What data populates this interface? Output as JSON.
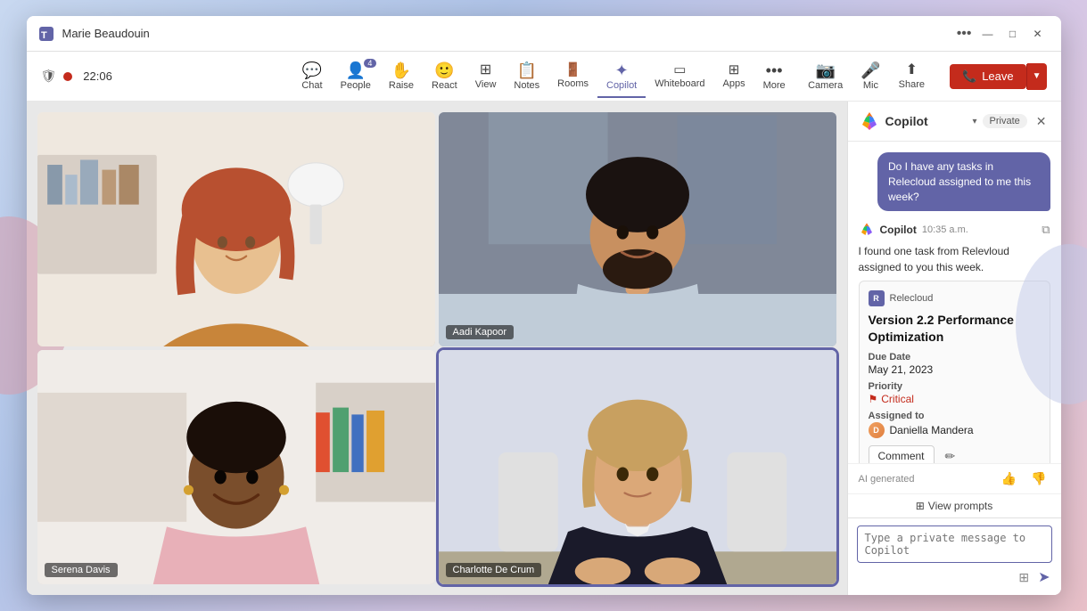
{
  "window": {
    "title": "Marie Beaudouin",
    "controls": {
      "more_label": "•••",
      "minimize_label": "—",
      "maximize_label": "□",
      "close_label": "✕"
    }
  },
  "toolbar": {
    "recording_time": "22:06",
    "items": [
      {
        "id": "chat",
        "label": "Chat",
        "icon": "💬",
        "active": false
      },
      {
        "id": "people",
        "label": "People",
        "icon": "👤",
        "active": false,
        "badge": "4"
      },
      {
        "id": "raise",
        "label": "Raise",
        "icon": "✋",
        "active": false
      },
      {
        "id": "react",
        "label": "React",
        "icon": "🙂",
        "active": false
      },
      {
        "id": "view",
        "label": "View",
        "icon": "⊞",
        "active": false
      },
      {
        "id": "notes",
        "label": "Notes",
        "icon": "📝",
        "active": false
      },
      {
        "id": "rooms",
        "label": "Rooms",
        "icon": "🚪",
        "active": false
      },
      {
        "id": "copilot",
        "label": "Copilot",
        "icon": "✦",
        "active": true
      },
      {
        "id": "whiteboard",
        "label": "Whiteboard",
        "icon": "⬜",
        "active": false
      },
      {
        "id": "apps",
        "label": "Apps",
        "icon": "⊞",
        "active": false
      },
      {
        "id": "more",
        "label": "More",
        "icon": "•••",
        "active": false
      }
    ],
    "media_items": [
      {
        "id": "camera",
        "label": "Camera",
        "icon": "📷"
      },
      {
        "id": "mic",
        "label": "Mic",
        "icon": "🎤"
      },
      {
        "id": "share",
        "label": "Share",
        "icon": "↑"
      }
    ],
    "leave_label": "Leave"
  },
  "video_tiles": [
    {
      "id": "tile-1",
      "name": "",
      "active_speaker": false,
      "bg": "room-bg-1"
    },
    {
      "id": "tile-2",
      "name": "Aadi Kapoor",
      "active_speaker": false,
      "bg": "room-bg-2"
    },
    {
      "id": "tile-3",
      "name": "Serena Davis",
      "active_speaker": false,
      "bg": "room-bg-3"
    },
    {
      "id": "tile-4",
      "name": "Charlotte De Crum",
      "active_speaker": true,
      "bg": "room-bg-4"
    }
  ],
  "copilot": {
    "title": "Copilot",
    "private_label": "Private",
    "close_label": "✕",
    "user_message": "Do I have any tasks in Relecloud assigned to me this week?",
    "bot_name": "Copilot",
    "bot_time": "10:35 a.m.",
    "bot_response": "I found one task from Relevloud assigned to you this week.",
    "task_card": {
      "source": "Relecloud",
      "title": "Version 2.2 Performance Optimization",
      "due_date_label": "Due Date",
      "due_date": "May 21, 2023",
      "priority_label": "Priority",
      "priority": "Critical",
      "assigned_to_label": "Assigned to",
      "assigned_to": "Daniella Mandera",
      "comment_btn": "Comment",
      "edit_btn": "✏"
    },
    "ai_generated_label": "AI generated",
    "view_prompts_label": "View prompts",
    "input_placeholder": "Type a private message to Copilot"
  }
}
